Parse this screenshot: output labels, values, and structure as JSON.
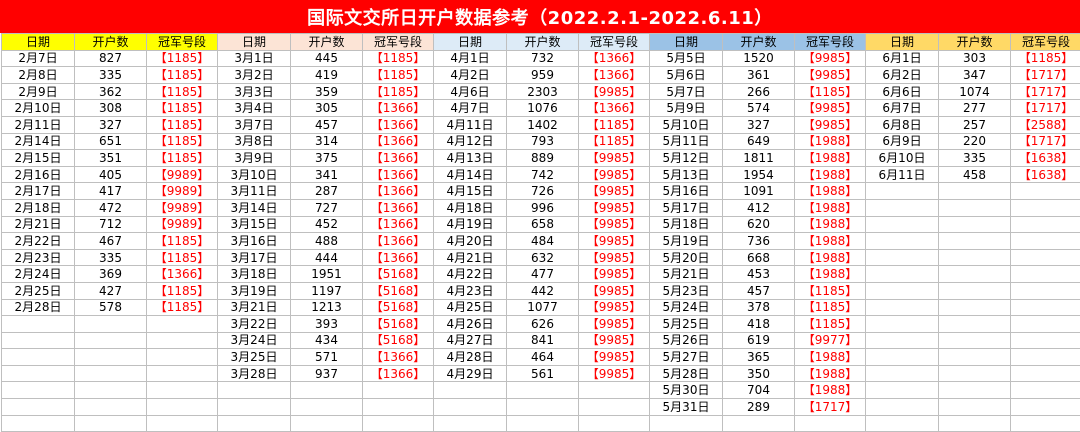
{
  "title": "国际文交所日开户数据参考（2022.2.1-2022.6.11）",
  "headers": [
    "日期",
    "开户数",
    "冠军号段"
  ],
  "colors": {
    "title_bg": "#ff0000",
    "title_text": "#ffffff",
    "header_groups": [
      "#ffff00",
      "#fce4d6",
      "#ddebf7",
      "#9bc2e6",
      "#ffd966"
    ],
    "champion_text": "#ff0000"
  },
  "months": [
    {
      "name": "February",
      "rows": [
        [
          "2月7日",
          "827",
          "【1185】"
        ],
        [
          "2月8日",
          "335",
          "【1185】"
        ],
        [
          "2月9日",
          "362",
          "【1185】"
        ],
        [
          "2月10日",
          "308",
          "【1185】"
        ],
        [
          "2月11日",
          "327",
          "【1185】"
        ],
        [
          "2月14日",
          "651",
          "【1185】"
        ],
        [
          "2月15日",
          "351",
          "【1185】"
        ],
        [
          "2月16日",
          "405",
          "【9989】"
        ],
        [
          "2月17日",
          "417",
          "【9989】"
        ],
        [
          "2月18日",
          "472",
          "【9989】"
        ],
        [
          "2月21日",
          "712",
          "【9989】"
        ],
        [
          "2月22日",
          "467",
          "【1185】"
        ],
        [
          "2月23日",
          "335",
          "【1185】"
        ],
        [
          "2月24日",
          "369",
          "【1366】"
        ],
        [
          "2月25日",
          "427",
          "【1185】"
        ],
        [
          "2月28日",
          "578",
          "【1185】"
        ]
      ]
    },
    {
      "name": "March",
      "rows": [
        [
          "3月1日",
          "445",
          "【1185】"
        ],
        [
          "3月2日",
          "419",
          "【1185】"
        ],
        [
          "3月3日",
          "359",
          "【1185】"
        ],
        [
          "3月4日",
          "305",
          "【1366】"
        ],
        [
          "3月7日",
          "457",
          "【1366】"
        ],
        [
          "3月8日",
          "314",
          "【1366】"
        ],
        [
          "3月9日",
          "375",
          "【1366】"
        ],
        [
          "3月10日",
          "341",
          "【1366】"
        ],
        [
          "3月11日",
          "287",
          "【1366】"
        ],
        [
          "3月14日",
          "727",
          "【1366】"
        ],
        [
          "3月15日",
          "452",
          "【1366】"
        ],
        [
          "3月16日",
          "488",
          "【1366】"
        ],
        [
          "3月17日",
          "444",
          "【1366】"
        ],
        [
          "3月18日",
          "1951",
          "【5168】"
        ],
        [
          "3月19日",
          "1197",
          "【5168】"
        ],
        [
          "3月21日",
          "1213",
          "【5168】"
        ],
        [
          "3月22日",
          "393",
          "【5168】"
        ],
        [
          "3月24日",
          "434",
          "【5168】"
        ],
        [
          "3月25日",
          "571",
          "【1366】"
        ],
        [
          "3月28日",
          "937",
          "【1366】"
        ]
      ]
    },
    {
      "name": "April",
      "rows": [
        [
          "4月1日",
          "732",
          "【1366】"
        ],
        [
          "4月2日",
          "959",
          "【1366】"
        ],
        [
          "4月6日",
          "2303",
          "【9985】"
        ],
        [
          "4月7日",
          "1076",
          "【1366】"
        ],
        [
          "4月11日",
          "1402",
          "【1185】"
        ],
        [
          "4月12日",
          "793",
          "【1185】"
        ],
        [
          "4月13日",
          "889",
          "【9985】"
        ],
        [
          "4月14日",
          "742",
          "【9985】"
        ],
        [
          "4月15日",
          "726",
          "【9985】"
        ],
        [
          "4月18日",
          "996",
          "【9985】"
        ],
        [
          "4月19日",
          "658",
          "【9985】"
        ],
        [
          "4月20日",
          "484",
          "【9985】"
        ],
        [
          "4月21日",
          "632",
          "【9985】"
        ],
        [
          "4月22日",
          "477",
          "【9985】"
        ],
        [
          "4月23日",
          "442",
          "【9985】"
        ],
        [
          "4月25日",
          "1077",
          "【9985】"
        ],
        [
          "4月26日",
          "626",
          "【9985】"
        ],
        [
          "4月27日",
          "841",
          "【9985】"
        ],
        [
          "4月28日",
          "464",
          "【9985】"
        ],
        [
          "4月29日",
          "561",
          "【9985】"
        ]
      ]
    },
    {
      "name": "May",
      "rows": [
        [
          "5月5日",
          "1520",
          "【9985】"
        ],
        [
          "5月6日",
          "361",
          "【9985】"
        ],
        [
          "5月7日",
          "266",
          "【1185】"
        ],
        [
          "5月9日",
          "574",
          "【9985】"
        ],
        [
          "5月10日",
          "327",
          "【9985】"
        ],
        [
          "5月11日",
          "649",
          "【1988】"
        ],
        [
          "5月12日",
          "1811",
          "【1988】"
        ],
        [
          "5月13日",
          "1954",
          "【1988】"
        ],
        [
          "5月16日",
          "1091",
          "【1988】"
        ],
        [
          "5月17日",
          "412",
          "【1988】"
        ],
        [
          "5月18日",
          "620",
          "【1988】"
        ],
        [
          "5月19日",
          "736",
          "【1988】"
        ],
        [
          "5月20日",
          "668",
          "【1988】"
        ],
        [
          "5月21日",
          "453",
          "【1988】"
        ],
        [
          "5月23日",
          "457",
          "【1185】"
        ],
        [
          "5月24日",
          "378",
          "【1185】"
        ],
        [
          "5月25日",
          "418",
          "【1185】"
        ],
        [
          "5月26日",
          "619",
          "【9977】"
        ],
        [
          "5月27日",
          "365",
          "【1988】"
        ],
        [
          "5月28日",
          "350",
          "【1988】"
        ],
        [
          "5月30日",
          "704",
          "【1988】"
        ],
        [
          "5月31日",
          "289",
          "【1717】"
        ]
      ]
    },
    {
      "name": "June",
      "rows": [
        [
          "6月1日",
          "303",
          "【1185】"
        ],
        [
          "6月2日",
          "347",
          "【1717】"
        ],
        [
          "6月6日",
          "1074",
          "【1717】"
        ],
        [
          "6月7日",
          "277",
          "【1717】"
        ],
        [
          "6月8日",
          "257",
          "【2588】"
        ],
        [
          "6月9日",
          "220",
          "【1717】"
        ],
        [
          "6月10日",
          "335",
          "【1638】"
        ],
        [
          "6月11日",
          "458",
          "【1638】"
        ]
      ]
    }
  ]
}
